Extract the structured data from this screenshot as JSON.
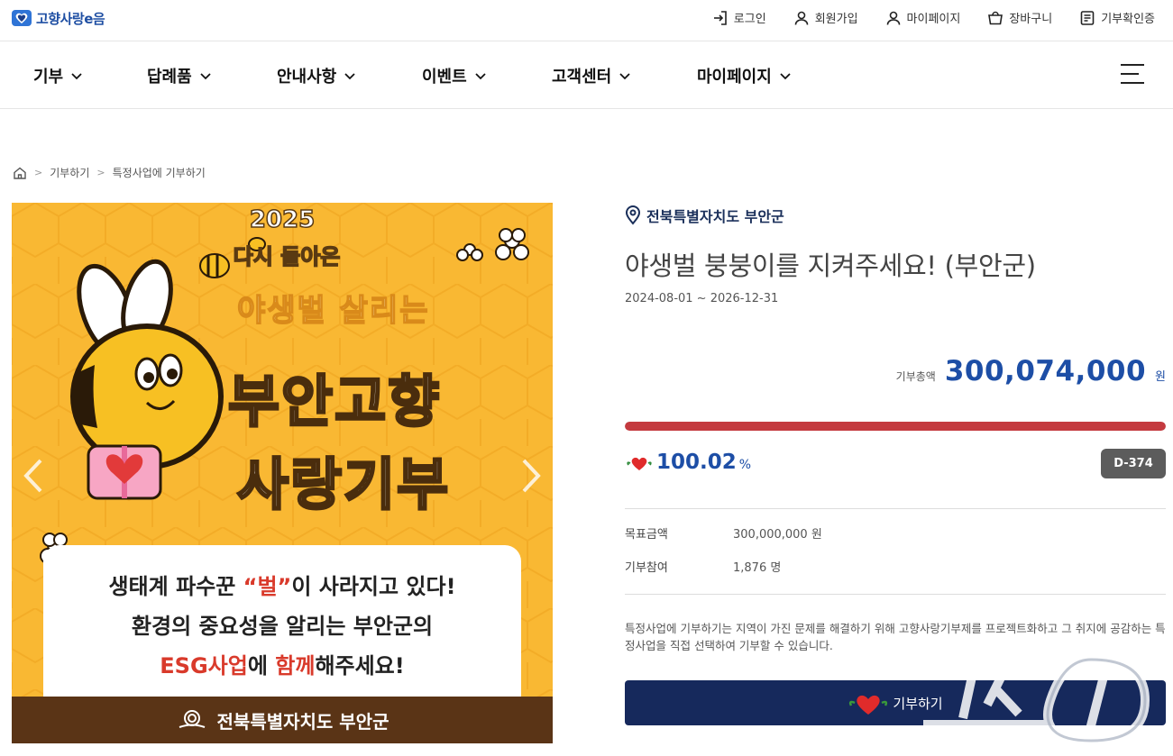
{
  "header": {
    "logo_text": "고향사랑e음",
    "util_links": [
      {
        "label": "로그인",
        "icon": "login-icon"
      },
      {
        "label": "회원가입",
        "icon": "user-icon"
      },
      {
        "label": "마이페이지",
        "icon": "user-icon"
      },
      {
        "label": "장바구니",
        "icon": "cart-icon"
      },
      {
        "label": "기부확인증",
        "icon": "certificate-icon"
      }
    ]
  },
  "nav": {
    "items": [
      "기부",
      "답례품",
      "안내사항",
      "이벤트",
      "고객센터",
      "마이페이지"
    ]
  },
  "breadcrumb": [
    "기부하기",
    "특정사업에 기부하기"
  ],
  "banner": {
    "year": "2025",
    "subtitle": "다시 돌아온",
    "line1": "야생벌 살리는",
    "big1": "부안고향",
    "big2": "사랑기부",
    "card_line1_a": "생태계 파수꾼 ",
    "card_line1_b": "“벌”",
    "card_line1_c": "이 사라지고 있다!",
    "card_line2": "환경의 중요성을 알리는 부안군의",
    "card_line3_a": "ESG사업",
    "card_line3_b": "에 ",
    "card_line3_c": "함께",
    "card_line3_d": "해주세요!",
    "footer": "전북특별자치도 부안군"
  },
  "project": {
    "region": "전북특별자치도 부안군",
    "title": "야생벌 붕붕이를 지켜주세요! (부안군)",
    "period": "2024-08-01 ~ 2026-12-31",
    "total_label": "기부총액",
    "total_value": "300,074,000",
    "total_unit": "원",
    "progress_fraction": 1.0,
    "percent": "100.02",
    "percent_unit": "%",
    "dday": "D-374",
    "goal_label": "목표금액",
    "goal_value": "300,000,000 원",
    "participants_label": "기부참여",
    "participants_value": "1,876 명",
    "description": "특정사업에 기부하기는 지역이 가진 문제를 해결하기 위해 고향사랑기부제를 프로젝트화하고 그 취지에 공감하는 특정사업을 직접 선택하여 기부할 수 있습니다.",
    "donate_label": "기부하기"
  },
  "watermark": "뉴스1",
  "colors": {
    "brand_blue": "#1d4ea6",
    "navy_button": "#16295c",
    "progress_red": "#c43a3f",
    "dday_gray": "#5c5c5c"
  }
}
